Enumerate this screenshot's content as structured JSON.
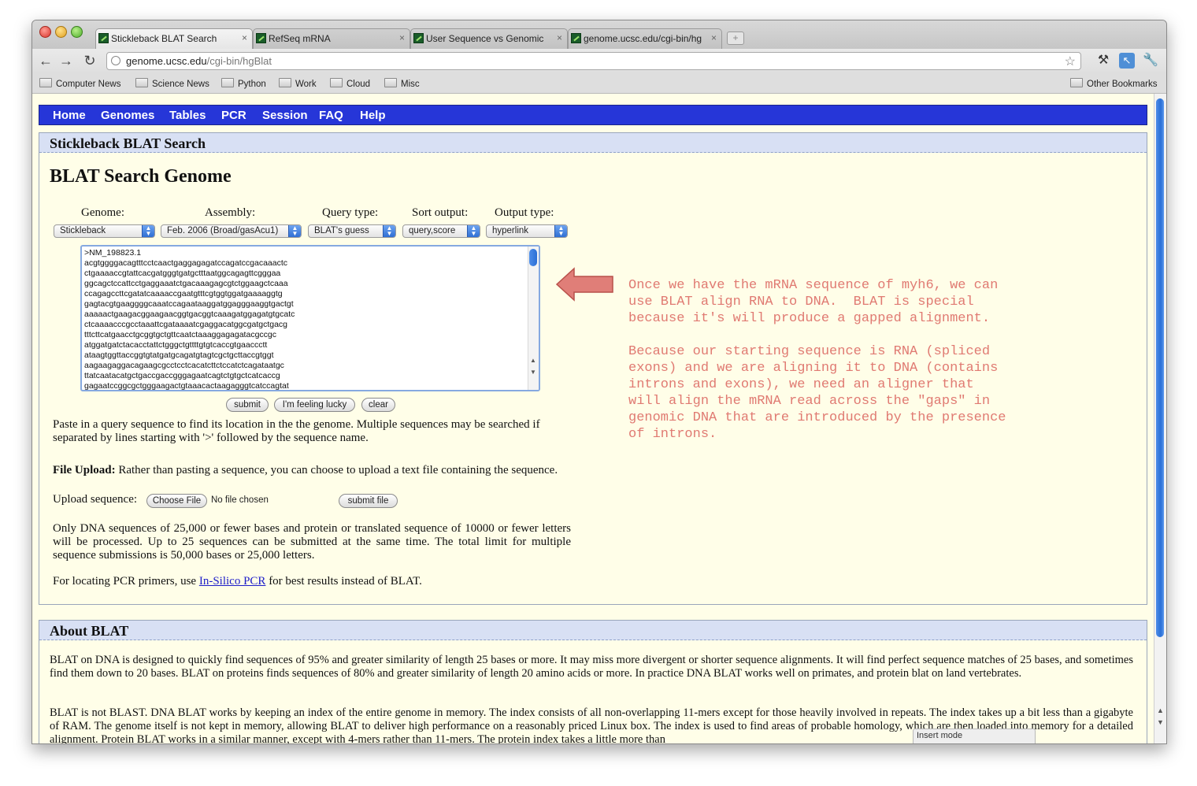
{
  "browser": {
    "tabs": [
      {
        "title": "Stickleback BLAT Search",
        "active": true
      },
      {
        "title": "RefSeq mRNA",
        "active": false
      },
      {
        "title": "User Sequence vs Genomic",
        "active": false
      },
      {
        "title": "genome.ucsc.edu/cgi-bin/hg",
        "active": false
      }
    ],
    "tab_close_glyph": "×",
    "new_tab_glyph": "+",
    "url_host": "genome.ucsc.edu",
    "url_path": "/cgi-bin/hgBlat",
    "bookmarks": [
      "Computer News",
      "Science News",
      "Python",
      "Work",
      "Cloud",
      "Misc"
    ],
    "other_bookmarks": "Other Bookmarks",
    "status_text": "Insert mode"
  },
  "nav": [
    "Home",
    "Genomes",
    "Tables",
    "PCR",
    "Session",
    "FAQ",
    "Help"
  ],
  "search_panel": {
    "title": "Stickleback BLAT Search",
    "heading": "BLAT Search Genome",
    "labels": {
      "genome": "Genome:",
      "assembly": "Assembly:",
      "query_type": "Query type:",
      "sort_output": "Sort output:",
      "output_type": "Output type:"
    },
    "selects": {
      "genome": "Stickleback",
      "assembly": "Feb. 2006 (Broad/gasAcu1)",
      "query_type": "BLAT's guess",
      "sort_output": "query,score",
      "output_type": "hyperlink"
    },
    "sequence": ">NM_198823.1\nacgtggggacagtttcctcaactgaggagagatccagatccgacaaactc\nctgaaaaccgtattcacgatgggtgatgctttaatggcagagttcgggaa\nggcagctccattcctgaggaaatctgacaaagagcgtctggaagctcaaa\nccagagccttcgatatcaaaaccgaatgtttcgtggtggatgaaaaggtg\ngagtacgtgaaggggcaaatccagaataaggatggagggaaggtgactgt\naaaaactgaagacggaagaacggtgacggtcaaagatggagatgtgcatc\nctcaaaacccgcctaaattcgataaaatcgaggacatggcgatgctgacg\ntttcttcatgaacctgcggtgctgttcaatctaaaggagagatacgccgc\natggatgatctacacctattctgggctgttttgtgtcaccgtgaaccctt\nataagtggttaccggtgtatgatgcagatgtagtcgctgcttaccgtggt\naagaagaggacagaagcgcctcctcacatcttctccatctcagataatgc\nttatcaatacatgctgaccgaccgggagaatcagtctgtgctcatcaccg\ngagaatccggcgctgggaagactgtaaacactaagagggtcatccagtat",
    "buttons": {
      "submit": "submit",
      "lucky": "I'm feeling lucky",
      "clear": "clear"
    },
    "paste_help": "Paste in a query sequence to find its location in the the genome. Multiple sequences may be searched if separated by lines starting with '>' followed by the sequence name.",
    "file_upload_bold": "File Upload:",
    "file_upload_text": " Rather than pasting a sequence, you can choose to upload a text file containing the sequence.",
    "upload_label": "Upload sequence:",
    "choose_file": "Choose File",
    "no_file": "No file chosen",
    "submit_file": "submit file",
    "limits_text": "Only DNA sequences of 25,000 or fewer bases and protein or translated sequence of 10000 or fewer letters will be processed. Up to 25 sequences can be submitted at the same time. The total limit for multiple sequence submissions is 50,000 bases or 25,000 letters.",
    "pcr_prefix": "For locating PCR primers, use ",
    "pcr_link": "In-Silico PCR",
    "pcr_suffix": " for best results instead of BLAT."
  },
  "annotation": {
    "text": "Once we have the mRNA sequence of myh6, we can\nuse BLAT align RNA to DNA.  BLAT is special\nbecause it's will produce a gapped alignment.\n\nBecause our starting sequence is RNA (spliced\nexons) and we are aligning it to DNA (contains\nintrons and exons), we need an aligner that\nwill align the mRNA read across the \"gaps\" in\ngenomic DNA that are introduced by the presence\nof introns.",
    "color": "#e07a72"
  },
  "about_panel": {
    "title": "About BLAT",
    "para1": "BLAT on DNA is designed to quickly find sequences of 95% and greater similarity of length 25 bases or more. It may miss more divergent or shorter sequence alignments. It will find perfect sequence matches of 25 bases, and sometimes find them down to 20 bases. BLAT on proteins finds sequences of 80% and greater similarity of length 20 amino acids or more. In practice DNA BLAT works well on primates, and protein blat on land vertebrates.",
    "para2": "BLAT is not BLAST. DNA BLAT works by keeping an index of the entire genome in memory. The index consists of all non-overlapping 11-mers except for those heavily involved in repeats. The index takes up a bit less than a gigabyte of RAM. The genome itself is not kept in memory, allowing BLAT to deliver high performance on a reasonably priced Linux box. The index is used to find areas of probable homology, which are then loaded into memory for a detailed alignment. Protein BLAT works in a similar manner, except with 4-mers rather than 11-mers. The protein index takes a little more than"
  },
  "colors": {
    "nav_bar": "#2636d8",
    "panel_header": "#d8e0f4",
    "page_bg": "#fffee8",
    "link": "#1d1dc9"
  }
}
